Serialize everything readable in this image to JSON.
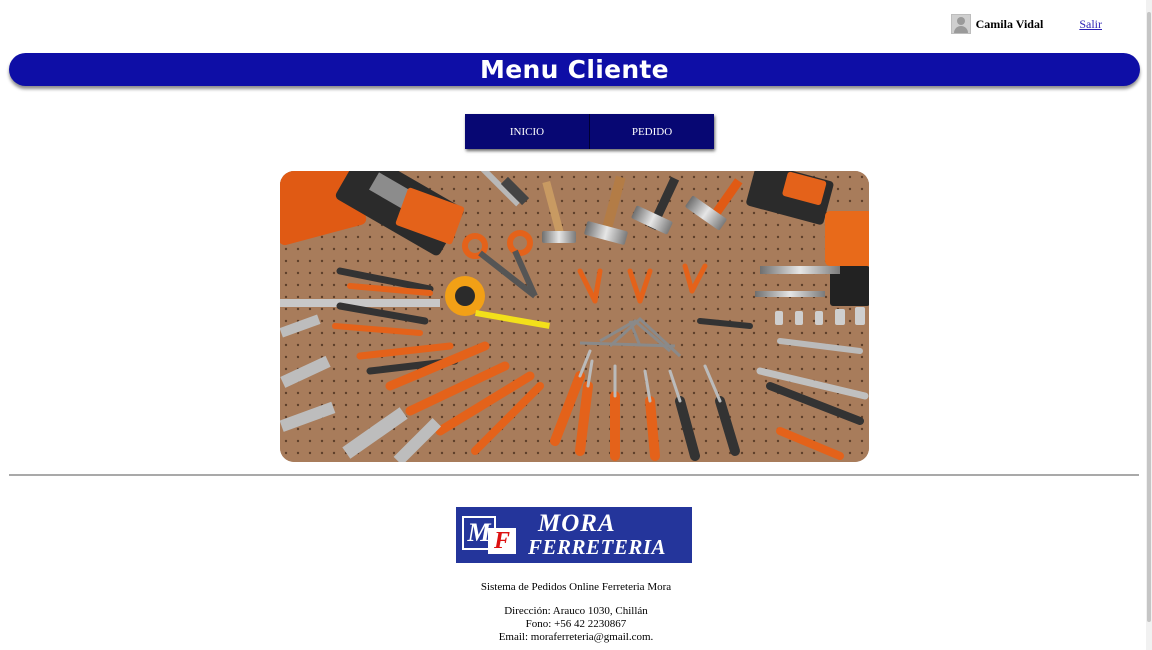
{
  "user": {
    "name": "Camila Vidal",
    "logout_label": "Salir"
  },
  "header": {
    "title": "Menu Cliente"
  },
  "nav": {
    "items": [
      {
        "label": "INICIO"
      },
      {
        "label": "PEDIDO"
      }
    ]
  },
  "hero": {
    "description": "tools"
  },
  "logo": {
    "text_top": "MORA",
    "text_bottom": "FERRETERIA",
    "m": "M",
    "f": "F"
  },
  "footer": {
    "system_name": "Sistema de Pedidos Online Ferreteria Mora",
    "address": "Dirección: Arauco 1030, Chillán",
    "phone": "Fono: +56 42 2230867",
    "email": "Email: moraferreteria@gmail.com."
  },
  "colors": {
    "banner": "#0e0ea6",
    "nav": "#070773",
    "logo_bg": "#24359b",
    "link": "#2a1fb5"
  }
}
